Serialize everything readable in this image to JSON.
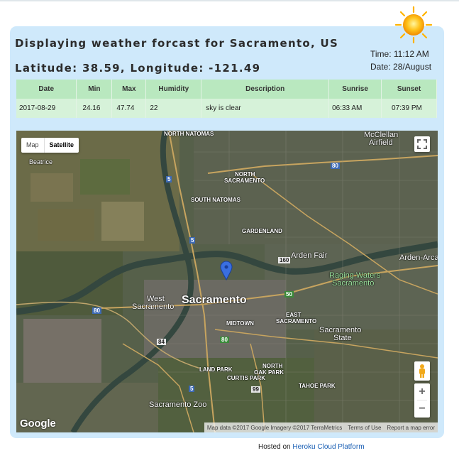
{
  "header": {
    "title": "Displaying weather forcast for Sacramento, US",
    "latlon": "Latitude: 38.59, Longitude: -121.49",
    "time": "Time: 11:12 AM",
    "date": "Date: 28/August",
    "icon": "sun-icon"
  },
  "table": {
    "columns": [
      "Date",
      "Min",
      "Max",
      "Humidity",
      "Description",
      "Sunrise",
      "Sunset"
    ],
    "rows": [
      [
        "2017-08-29",
        "24.16",
        "47.74",
        "22",
        "sky is clear",
        "06:33 AM",
        "07:39 PM"
      ]
    ]
  },
  "map": {
    "type_buttons": {
      "map": "Map",
      "satellite": "Satellite"
    },
    "selected_type": "Satellite",
    "logo": "Google",
    "attribution": {
      "data": "Map data ©2017 Google Imagery ©2017 TerraMetrics",
      "terms": "Terms of Use",
      "report": "Report a map error"
    },
    "zoom_in": "+",
    "zoom_out": "−",
    "labels": {
      "north_natomas": "NORTH NATOMAS",
      "mcclellan": "McClellan",
      "airfield": "Airfield",
      "beatrice": "Beatrice",
      "north_sac_1": "NORTH",
      "north_sac_2": "SACRAMENTO",
      "south_natomas": "SOUTH NATOMAS",
      "gardenland": "GARDENLAND",
      "arden_fair": "Arden Fair",
      "arden_arcade": "Arden-Arca",
      "raging_1": "Raging Waters",
      "raging_2": "Sacramento",
      "west_sac_1": "West",
      "west_sac_2": "Sacramento",
      "sacramento": "Sacramento",
      "east_sac_1": "EAST",
      "east_sac_2": "SACRAMENTO",
      "midtown": "MIDTOWN",
      "sac_state_1": "Sacramento",
      "sac_state_2": "State",
      "land_park": "LAND PARK",
      "north_oak_1": "NORTH",
      "north_oak_2": "OAK PARK",
      "curtis_park": "CURTIS PARK",
      "tahoe_park": "TAHOE PARK",
      "sac_zoo": "Sacramento Zoo",
      "r80a": "80",
      "r80b": "80",
      "r80c": "80",
      "r5a": "5",
      "r5b": "5",
      "r5c": "5",
      "r160": "160",
      "r50": "50",
      "r99": "99",
      "r84": "84"
    }
  },
  "footer": {
    "hosted_prefix": "Hosted on",
    "hosted_link": "Heroku Cloud Platform"
  }
}
